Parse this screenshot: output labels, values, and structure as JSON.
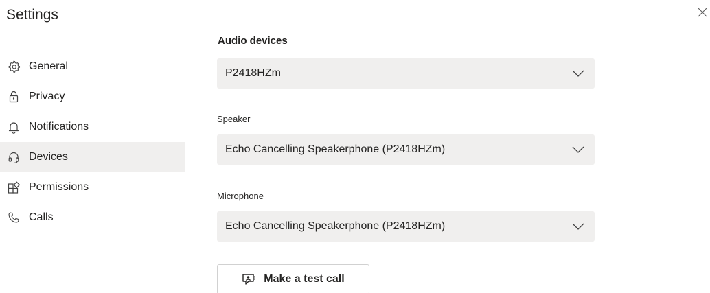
{
  "window": {
    "title": "Settings",
    "close_icon": "close-icon"
  },
  "sidebar": {
    "items": [
      {
        "label": "General",
        "icon": "gear-icon",
        "active": false
      },
      {
        "label": "Privacy",
        "icon": "lock-icon",
        "active": false
      },
      {
        "label": "Notifications",
        "icon": "bell-icon",
        "active": false
      },
      {
        "label": "Devices",
        "icon": "headset-icon",
        "active": true
      },
      {
        "label": "Permissions",
        "icon": "permissions-icon",
        "active": false
      },
      {
        "label": "Calls",
        "icon": "phone-icon",
        "active": false
      }
    ],
    "active_bg": "#f0efee"
  },
  "devices": {
    "section_title": "Audio devices",
    "audio_device_value": "P2418HZm",
    "speaker_label": "Speaker",
    "speaker_value": "Echo Cancelling Speakerphone (P2418HZm)",
    "microphone_label": "Microphone",
    "microphone_value": "Echo Cancelling Speakerphone (P2418HZm)",
    "test_call_label": "Make a test call",
    "test_call_icon": "test-call-icon"
  },
  "colors": {
    "text": "#252423",
    "field_bg": "#f0efee",
    "border": "#d1d1d1"
  }
}
